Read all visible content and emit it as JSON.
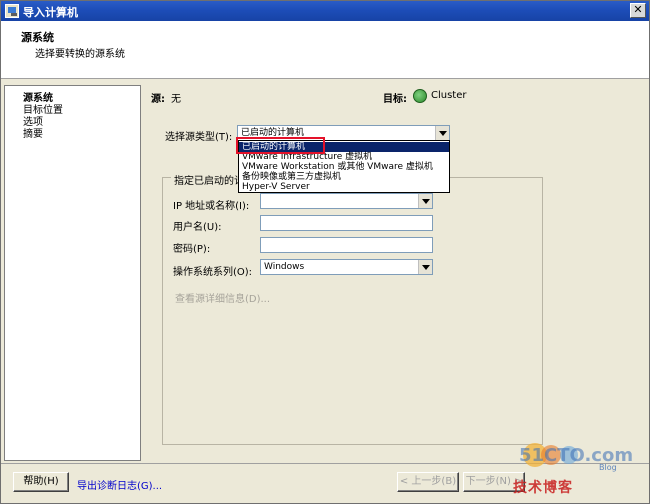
{
  "window": {
    "title": "导入计算机",
    "close_glyph": "✕"
  },
  "header": {
    "title": "源系统",
    "subtitle": "选择要转换的源系统"
  },
  "steps": [
    "源系统",
    "目标位置",
    "选项",
    "摘要"
  ],
  "main": {
    "source_label": "源:",
    "source_value": "无",
    "target_label": "目标:",
    "target_value": "Cluster",
    "source_type_label": "选择源类型(T):",
    "source_type_value": "已启动的计算机",
    "dropdown_options": [
      "已启动的计算机",
      "VMware Infrastructure 虚拟机",
      "VMware Workstation 或其他 VMware 虚拟机",
      "备份映像或第三方虚拟机",
      "Hyper-V Server"
    ],
    "group_title": "指定已启动的计",
    "ip_label": "IP 地址或名称(I):",
    "user_label": "用户名(U):",
    "password_label": "密码(P):",
    "os_family_label": "操作系统系列(O):",
    "os_family_value": "Windows",
    "view_details": "查看源详细信息(D)..."
  },
  "bottom": {
    "help_button": "帮助(H)",
    "export_log_link": "导出诊断日志(G)...",
    "back_button": "< 上一步(B)",
    "next_button": "下一步(N) >"
  },
  "watermark": {
    "logo_text": "51CTO.com",
    "slogan": "技术博客",
    "blog_tag": "Blog"
  },
  "colors": {
    "titlebar": "#1d4db8",
    "selection": "#0a246a",
    "highlight": "#e4122a",
    "window_bg": "#ece9d8"
  }
}
